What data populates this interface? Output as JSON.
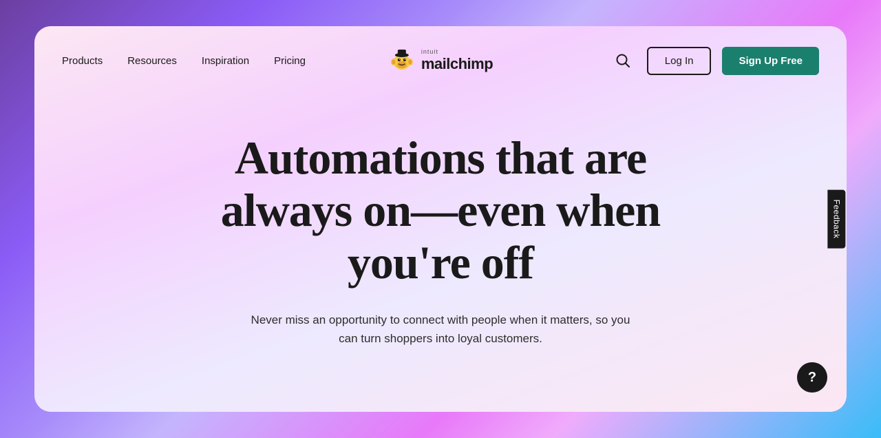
{
  "page": {
    "background": "gradient",
    "card_bg": "#fce7f3"
  },
  "navbar": {
    "nav_items": [
      {
        "label": "Products",
        "id": "products"
      },
      {
        "label": "Resources",
        "id": "resources"
      },
      {
        "label": "Inspiration",
        "id": "inspiration"
      },
      {
        "label": "Pricing",
        "id": "pricing"
      }
    ],
    "logo_intuit": "intuit",
    "logo_main": "mailchimp",
    "login_label": "Log In",
    "signup_label": "Sign Up Free"
  },
  "hero": {
    "title": "Automations that are always on—even when you're off",
    "subtitle": "Never miss an opportunity to connect with people when it matters, so you can turn shoppers into loyal customers."
  },
  "sidebar": {
    "feedback_label": "Feedback"
  },
  "help": {
    "label": "?"
  }
}
